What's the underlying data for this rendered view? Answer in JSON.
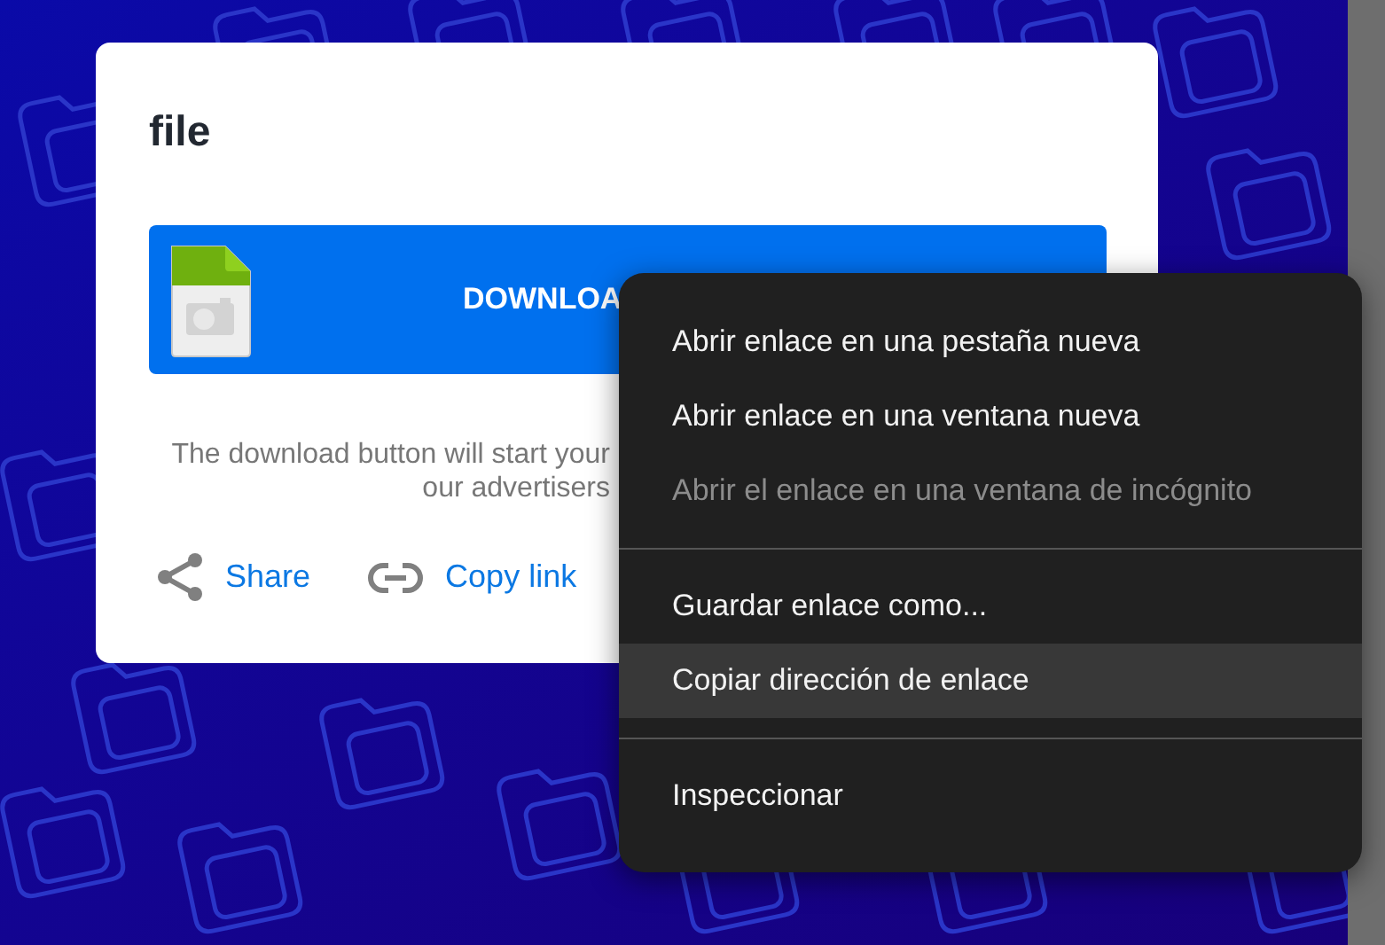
{
  "card": {
    "title": "file",
    "download_button": {
      "label": "DOWNLOA"
    },
    "description_lines": [
      "The download button will start your",
      "our advertisers"
    ],
    "actions": [
      {
        "kind": "share",
        "label": "Share"
      },
      {
        "kind": "link",
        "label": "Copy link"
      }
    ]
  },
  "context_menu": {
    "groups": [
      [
        {
          "label": "Abrir enlace en una pestaña nueva",
          "disabled": false,
          "selected": false
        },
        {
          "label": "Abrir enlace en una ventana nueva",
          "disabled": false,
          "selected": false
        },
        {
          "label": "Abrir el enlace en una ventana de incógnito",
          "disabled": true,
          "selected": false
        }
      ],
      [
        {
          "label": "Guardar enlace como...",
          "disabled": false,
          "selected": false
        },
        {
          "label": "Copiar dirección de enlace",
          "disabled": false,
          "selected": true
        }
      ],
      [
        {
          "label": "Inspeccionar",
          "disabled": false,
          "selected": false
        }
      ]
    ]
  }
}
